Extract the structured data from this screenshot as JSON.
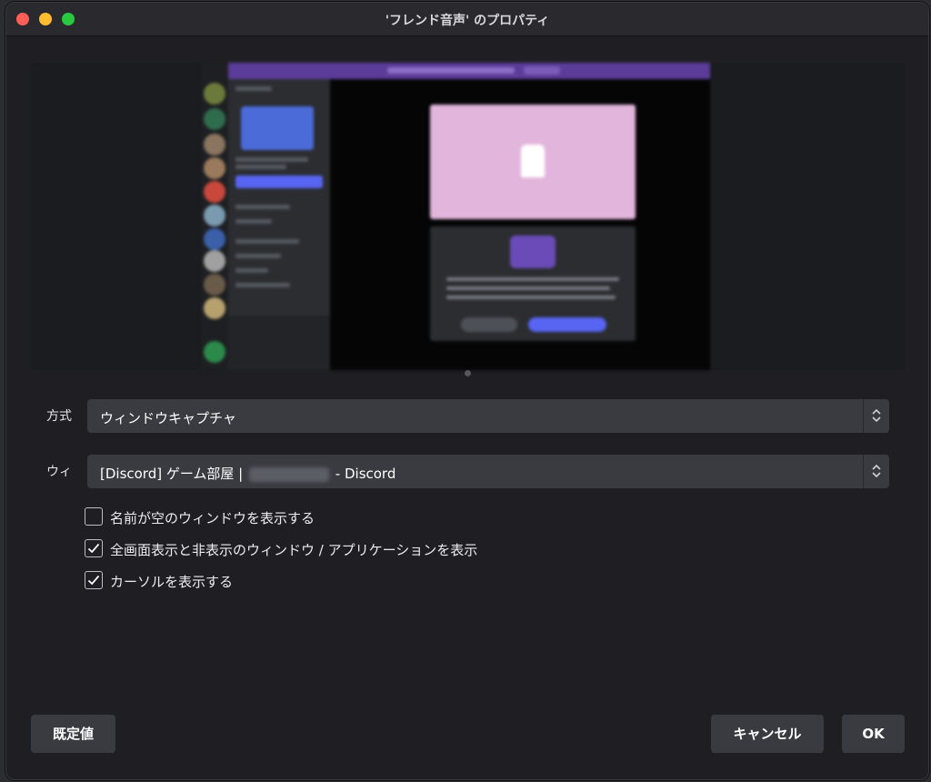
{
  "window": {
    "title": "'フレンド音声' のプロパティ"
  },
  "form": {
    "method": {
      "label": "方式",
      "value": "ウィンドウキャプチャ"
    },
    "window_select": {
      "label": "ウィ",
      "value_prefix": "[Discord] ゲーム部屋 |",
      "value_suffix": "- Discord"
    },
    "checkboxes": [
      {
        "label": "名前が空のウィンドウを表示する",
        "checked": false
      },
      {
        "label": "全画面表示と非表示のウィンドウ / アプリケーションを表示",
        "checked": true
      },
      {
        "label": "カーソルを表示する",
        "checked": true
      }
    ]
  },
  "buttons": {
    "defaults": "既定値",
    "cancel": "キャンセル",
    "ok": "OK"
  }
}
